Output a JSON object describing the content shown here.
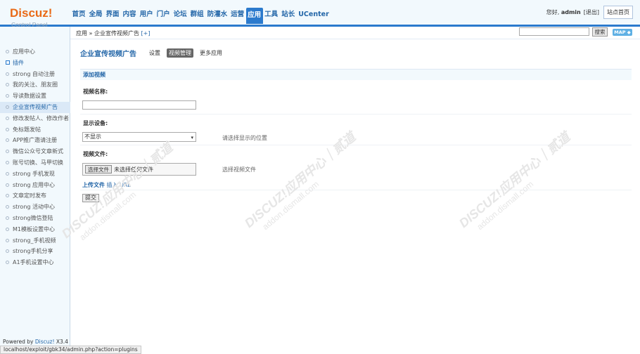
{
  "logo": {
    "brand": "Discuz!",
    "sub": "Control Panel"
  },
  "topnav": [
    "首页",
    "全局",
    "界面",
    "内容",
    "用户",
    "门户",
    "论坛",
    "群组",
    "防灌水",
    "运营",
    "应用",
    "工具",
    "站长",
    "UCenter"
  ],
  "topnav_active": "应用",
  "user": {
    "greeting": "您好, ",
    "name": "admin",
    "logout": "[退出]",
    "home_button": "站点首页"
  },
  "breadcrumb": {
    "text": "应用 » 企业宣传视频广告",
    "plus": "[+]"
  },
  "search": {
    "button": "搜索",
    "map": "MAP ◆"
  },
  "sidebar": {
    "items": [
      "应用中心",
      "插件",
      "strong 自动注册",
      "我的关注、朋友圈",
      "导读数据设置",
      "企业宣传视频广告",
      "修改发帖人、修改作者",
      "免标题发帖",
      "APP推广邀请注册",
      "微信公众号文章新式",
      "账号切换、马甲切换",
      "strong 手机发现",
      "strong 应用中心",
      "文章定时发布",
      "strong 活动中心",
      "strong微信登陆",
      "M1模板设置中心",
      "strong_手机视频",
      "strong手机分享",
      "A1手机设置中心"
    ],
    "powered_prefix": "Powered by ",
    "powered_link": "Discuz!",
    "powered_ver": " X3.4"
  },
  "main": {
    "title": "企业宣传视频广告",
    "tabs": [
      "设置",
      "视频管理",
      "更多应用"
    ],
    "active_tab": "视频管理",
    "section": "添加视频",
    "video_name_label": "视频名称:",
    "device_label": "显示设备:",
    "device_value": "不显示",
    "device_hint": "请选择显示的位置",
    "file_label": "视频文件:",
    "file_choose": "选择文件",
    "file_none": "未选择任何文件",
    "file_hint": "选择视频文件",
    "upload_link1": "上传文件",
    "upload_link2": "插入 URL",
    "submit": "提交"
  },
  "watermark": {
    "big": "DISCUZ!应用中心｜贰道",
    "small": "addon.dismall.com"
  },
  "statusbar": "localhost/exploit/gbk34/admin.php?action=plugins"
}
